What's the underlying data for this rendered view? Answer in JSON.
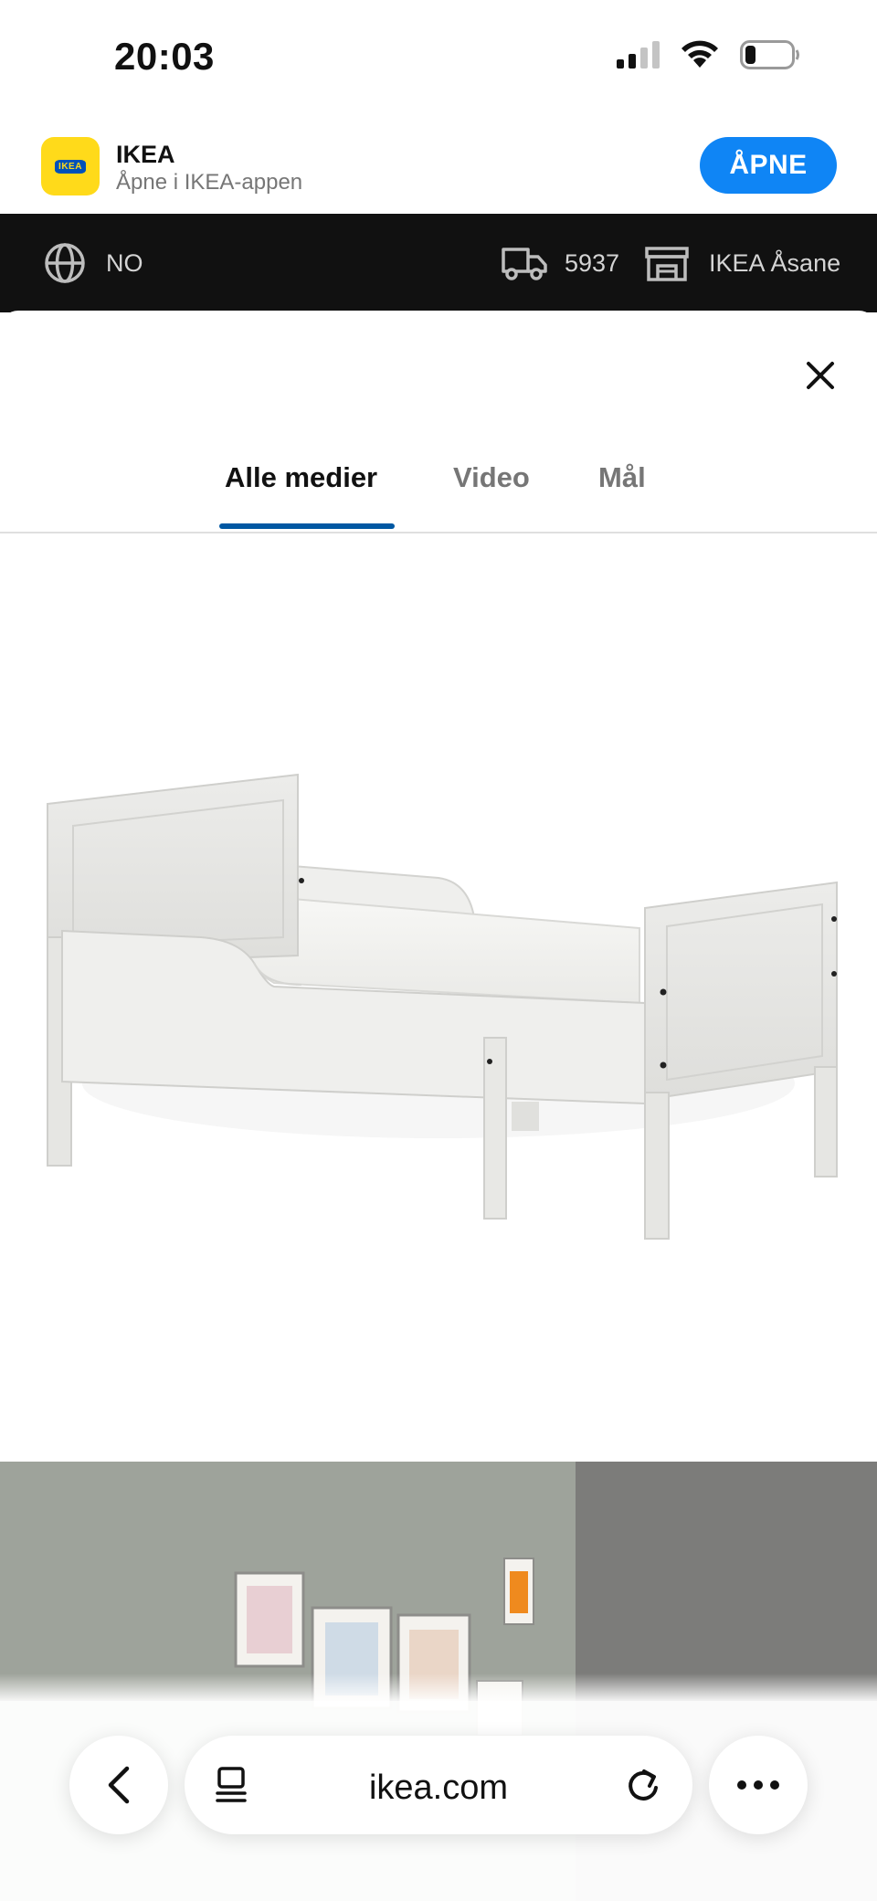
{
  "status_bar": {
    "time": "20:03",
    "battery_level": 0.22
  },
  "app_banner": {
    "app_name": "IKEA",
    "logo_text": "IKEA",
    "subtitle": "Åpne i IKEA-appen",
    "open_label": "ÅPNE",
    "accent_color": "#0f85f5"
  },
  "topbar": {
    "language": "NO",
    "postcode": "5937",
    "store": "IKEA Åsane"
  },
  "media_modal": {
    "tabs": [
      {
        "label": "Alle medier",
        "active": true
      },
      {
        "label": "Video",
        "active": false
      },
      {
        "label": "Mål",
        "active": false
      }
    ],
    "indicator_color": "#0058a3"
  },
  "browser": {
    "url": "ikea.com"
  }
}
